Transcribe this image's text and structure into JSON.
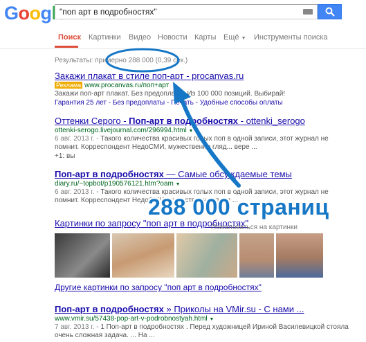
{
  "logo": {
    "text": "Google",
    "letters": [
      "G",
      "o",
      "o",
      "g",
      "l",
      "e"
    ],
    "colors": [
      "#4285f4",
      "#ea4335",
      "#fbbc05",
      "#4285f4",
      "#34a853",
      "#ea4335"
    ]
  },
  "search": {
    "query": "\"поп арт в подробностях\""
  },
  "tabs": [
    "Поиск",
    "Картинки",
    "Видео",
    "Новости",
    "Карты",
    "Ещё",
    "Инструменты поиска"
  ],
  "stats": "Результаты: примерно 288 000 (0,39 сек.)",
  "ad": {
    "title": "Закажи плакат в стиле поп-арт - procanvas.ru",
    "badge": "Реклама",
    "url": "www.procanvas.ru/поп+арт",
    "snippet": "Закажи поп-арт плакат. Без предоплаты. Из 100 000 позиций. Выбирай!",
    "sitelinks": "Гарантия 25 лет - Без предоплаты - Печать - Удобные способы оплаты"
  },
  "results": [
    {
      "title_pre": "Оттенки Серого - ",
      "title_bold": "Поп-арт в подробностях",
      "title_post": " - ottenki_serogo",
      "url": "ottenki-serogo.livejournal.com/296994.html",
      "date": "6 авг. 2013 г. - ",
      "snippet": "Такого количества красивых голых поп в одной записи, этот журнал не помнит. Корреспондент НедоСМИ, мужественно гляд... вере ...",
      "extra": "+1: вы"
    },
    {
      "title_pre": "",
      "title_bold": "Поп-арт в подробностях",
      "title_post": " — Самые обсуждаемые темы",
      "url": "diary.ru/~topbot/p190576121.htm?oam",
      "date": "6 авг. 2013 г. - ",
      "snippet": "Такого количества красивых голых поп в одной записи, этот журнал не помнит. Корреспондент НедоСМИ, мужественно глядя ...",
      "extra": ""
    }
  ],
  "images": {
    "heading": "Картинки по запросу \"поп арт в подробностях\"",
    "report": "Пожаловаться на картинки",
    "more": "Другие картинки по запросу \"поп арт в подробностях\""
  },
  "last": {
    "title_pre": "",
    "title_bold": "Поп-арт в подробностях",
    "title_post": " » Приколы на VMir.su - С нами ...",
    "url": "www.vmir.su/57438-pop-art-v-podrobnostyah.html",
    "date": "7 авг. 2013 г. - ",
    "snippet": "1 Поп-арт в подробностях . Перед художницей Ириной Василевицкой стояла очень сложная задача. ... На ..."
  },
  "callout": "288 000 страниц",
  "accent": "#1677c6"
}
